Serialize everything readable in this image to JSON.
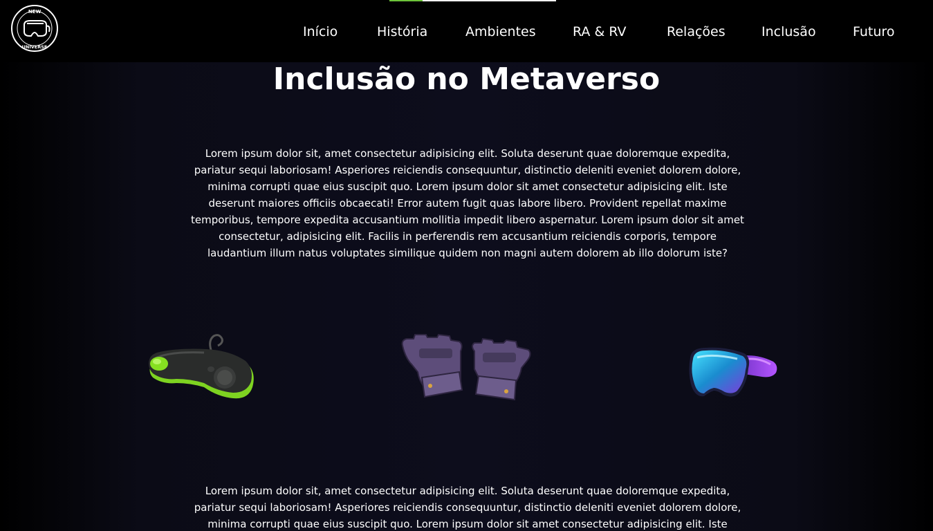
{
  "logo": {
    "text_top": "NEW",
    "text_bottom": "UNIVERSE",
    "icon": "vr-headset-logo-icon"
  },
  "nav": {
    "items": [
      {
        "label": "Início"
      },
      {
        "label": "História"
      },
      {
        "label": "Ambientes"
      },
      {
        "label": "RA & RV"
      },
      {
        "label": "Relações"
      },
      {
        "label": "Inclusão"
      },
      {
        "label": "Futuro"
      }
    ]
  },
  "main": {
    "title": "Inclusão no Metaverso",
    "paragraph_1": "Lorem ipsum dolor sit, amet consectetur adipisicing elit. Soluta deserunt quae doloremque expedita, pariatur sequi laboriosam! Asperiores reiciendis consequuntur, distinctio deleniti eveniet dolorem dolore, minima corrupti quae eius suscipit quo. Lorem ipsum dolor sit amet consectetur adipisicing elit. Iste deserunt maiores officiis obcaecati! Error autem fugit quas labore libero. Provident repellat maxime temporibus, tempore expedita accusantium mollitia impedit libero aspernatur. Lorem ipsum dolor sit amet consectetur, adipisicing elit. Facilis in perferendis rem accusantium reiciendis corporis, tempore laudantium illum natus voluptates similique quidem non magni autem dolorem ab illo dolorum iste?",
    "images": [
      {
        "icon": "game-controller-icon"
      },
      {
        "icon": "vr-gloves-icon"
      },
      {
        "icon": "vr-headset-icon"
      }
    ],
    "paragraph_2": "Lorem ipsum dolor sit, amet consectetur adipisicing elit. Soluta deserunt quae doloremque expedita, pariatur sequi laboriosam! Asperiores reiciendis consequuntur, distinctio deleniti eveniet dolorem dolore, minima corrupti quae eius suscipit quo. Lorem ipsum dolor sit amet consectetur adipisicing elit. Iste deserunt maiores officiis"
  },
  "colors": {
    "nav_background": "#000000",
    "page_background": "#0d0d1c",
    "text": "#ffffff",
    "accent_green": "#7ed321",
    "glove_purple": "#5d4d7a"
  }
}
